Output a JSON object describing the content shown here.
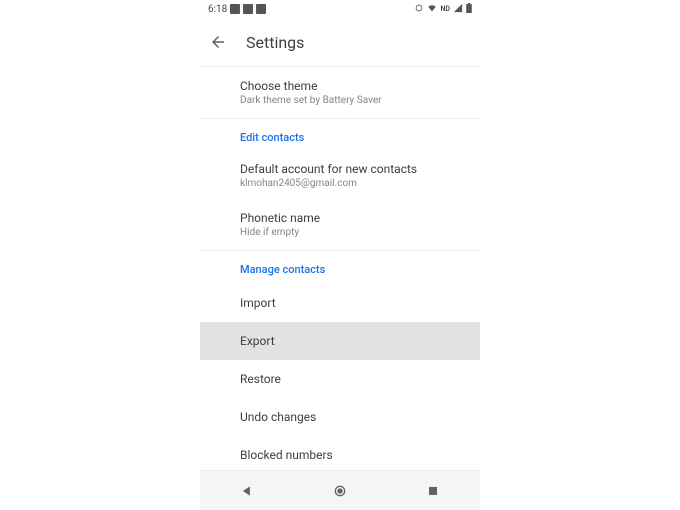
{
  "status": {
    "time": "6:18",
    "nd": "ND"
  },
  "header": {
    "title": "Settings"
  },
  "theme": {
    "title": "Choose theme",
    "sub": "Dark theme set by Battery Saver"
  },
  "edit_section": {
    "header": "Edit contacts",
    "default_account": {
      "title": "Default account for new contacts",
      "sub": "klmohan2405@gmail.com"
    },
    "phonetic": {
      "title": "Phonetic name",
      "sub": "Hide if empty"
    }
  },
  "manage_section": {
    "header": "Manage contacts",
    "import": "Import",
    "export": "Export",
    "restore": "Restore",
    "undo": "Undo changes",
    "blocked": "Blocked numbers"
  }
}
